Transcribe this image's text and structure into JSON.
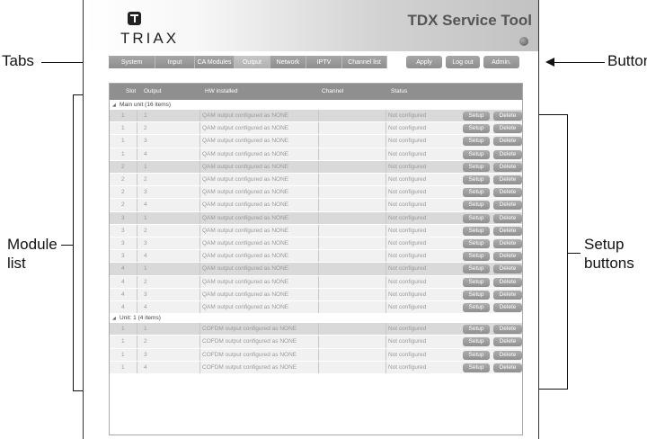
{
  "annotations": {
    "tabs": "Tabs",
    "buttons": "Buttons",
    "module_list_line1": "Module",
    "module_list_line2": "list",
    "setup_buttons_line1": "Setup",
    "setup_buttons_line2": "buttons"
  },
  "header": {
    "logo_text": "TRIAX",
    "title": "TDX Service Tool"
  },
  "tabs": [
    "System",
    "Input",
    "CA Modules",
    "Output",
    "Network",
    "IPTV",
    "Channel list"
  ],
  "active_tab": "Output",
  "buttons": [
    "Apply",
    "Log out",
    "Admin."
  ],
  "table": {
    "columns": [
      "Slot",
      "Output",
      "HW installed",
      "Channel",
      "Status"
    ],
    "setup_label": "Setup",
    "delete_label": "Delete",
    "groups": [
      {
        "label": "Main unit (16 items)",
        "rows": [
          {
            "slot": "1",
            "output": "1",
            "hw": "QAM output configured as NONE",
            "channel": "",
            "status": "Not configured"
          },
          {
            "slot": "1",
            "output": "2",
            "hw": "QAM output configured as NONE",
            "channel": "",
            "status": "Not configured"
          },
          {
            "slot": "1",
            "output": "3",
            "hw": "QAM output configured as NONE",
            "channel": "",
            "status": "Not configured"
          },
          {
            "slot": "1",
            "output": "4",
            "hw": "QAM output configured as NONE",
            "channel": "",
            "status": "Not configured"
          },
          {
            "slot": "2",
            "output": "1",
            "hw": "QAM output configured as NONE",
            "channel": "",
            "status": "Not configured"
          },
          {
            "slot": "2",
            "output": "2",
            "hw": "QAM output configured as NONE",
            "channel": "",
            "status": "Not configured"
          },
          {
            "slot": "2",
            "output": "3",
            "hw": "QAM output configured as NONE",
            "channel": "",
            "status": "Not configured"
          },
          {
            "slot": "2",
            "output": "4",
            "hw": "QAM output configured as NONE",
            "channel": "",
            "status": "Not configured"
          },
          {
            "slot": "3",
            "output": "1",
            "hw": "QAM output configured as NONE",
            "channel": "",
            "status": "Not configured"
          },
          {
            "slot": "3",
            "output": "2",
            "hw": "QAM output configured as NONE",
            "channel": "",
            "status": "Not configured"
          },
          {
            "slot": "3",
            "output": "3",
            "hw": "QAM output configured as NONE",
            "channel": "",
            "status": "Not configured"
          },
          {
            "slot": "3",
            "output": "4",
            "hw": "QAM output configured as NONE",
            "channel": "",
            "status": "Not configured"
          },
          {
            "slot": "4",
            "output": "1",
            "hw": "QAM output configured as NONE",
            "channel": "",
            "status": "Not configured"
          },
          {
            "slot": "4",
            "output": "2",
            "hw": "QAM output configured as NONE",
            "channel": "",
            "status": "Not configured"
          },
          {
            "slot": "4",
            "output": "3",
            "hw": "QAM output configured as NONE",
            "channel": "",
            "status": "Not configured"
          },
          {
            "slot": "4",
            "output": "4",
            "hw": "QAM output configured as NONE",
            "channel": "",
            "status": "Not configured"
          }
        ]
      },
      {
        "label": "Unit: 1 (4 items)",
        "rows": [
          {
            "slot": "1",
            "output": "1",
            "hw": "COFDM output configured as NONE",
            "channel": "",
            "status": "Not configured"
          },
          {
            "slot": "1",
            "output": "2",
            "hw": "COFDM output configured as NONE",
            "channel": "",
            "status": "Not configured"
          },
          {
            "slot": "1",
            "output": "3",
            "hw": "COFDM output configured as NONE",
            "channel": "",
            "status": "Not configured"
          },
          {
            "slot": "1",
            "output": "4",
            "hw": "COFDM output configured as NONE",
            "channel": "",
            "status": "Not configured"
          }
        ]
      }
    ]
  }
}
